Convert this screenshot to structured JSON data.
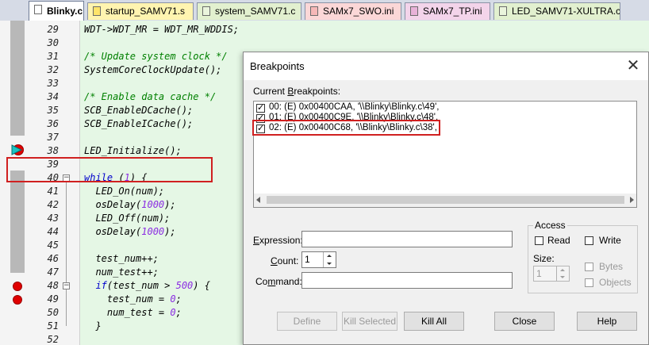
{
  "tabs": [
    {
      "label": "Blinky.c",
      "active": true,
      "color": "#ffffff",
      "icon": "c-file-icon"
    },
    {
      "label": "startup_SAMV71.s",
      "color": "#fff4b0",
      "icon": "asm-file-icon"
    },
    {
      "label": "system_SAMV71.c",
      "color": "#e2f0cf",
      "icon": "c-file-icon"
    },
    {
      "label": "SAMx7_SWO.ini",
      "color": "#fbd7d7",
      "icon": "ini-file-icon"
    },
    {
      "label": "SAMx7_TP.ini",
      "color": "#f3d4ea",
      "icon": "ini-file-icon"
    },
    {
      "label": "LED_SAMV71-XULTRA.c",
      "color": "#e2f0cf",
      "icon": "c-file-icon"
    }
  ],
  "editor": {
    "lines": [
      {
        "n": "29",
        "text": "WDT->WDT_MR = WDT_MR_WDDIS;"
      },
      {
        "n": "30",
        "text": ""
      },
      {
        "n": "31",
        "text": "/* Update system clock */"
      },
      {
        "n": "32",
        "text": "SystemCoreClockUpdate();"
      },
      {
        "n": "33",
        "text": ""
      },
      {
        "n": "34",
        "text": "/* Enable data cache */"
      },
      {
        "n": "35",
        "text": "SCB_EnableDCache();"
      },
      {
        "n": "36",
        "text": "SCB_EnableICache();"
      },
      {
        "n": "37",
        "text": ""
      },
      {
        "n": "38",
        "text": "LED_Initialize();"
      },
      {
        "n": "39",
        "text": ""
      },
      {
        "n": "40",
        "kw": "while",
        "num": "1",
        "rest": " {",
        "pre": " ("
      },
      {
        "n": "41",
        "text": "  LED_On(num);"
      },
      {
        "n": "42",
        "pre": "  osDelay(",
        "num": "1000",
        "rest": ");"
      },
      {
        "n": "43",
        "text": "  LED_Off(num);"
      },
      {
        "n": "44",
        "pre": "  osDelay(",
        "num": "1000",
        "rest": ");"
      },
      {
        "n": "45",
        "text": ""
      },
      {
        "n": "46",
        "text": "  test_num++;"
      },
      {
        "n": "47",
        "text": "  num_test++;"
      },
      {
        "n": "48",
        "kw": "  if",
        "pre": "(test_num > ",
        "num": "500",
        "rest": ") {"
      },
      {
        "n": "49",
        "pre": "    test_num = ",
        "num": "0",
        "rest": ";"
      },
      {
        "n": "50",
        "pre": "    num_test = ",
        "num": "0",
        "rest": ";"
      },
      {
        "n": "51",
        "text": "  }"
      },
      {
        "n": "52",
        "text": ""
      }
    ]
  },
  "dialog": {
    "title": "Breakpoints",
    "close_glyph": "✕",
    "current_label_pre": "Current ",
    "current_label_u": "B",
    "current_label_post": "reakpoints:",
    "breakpoints": [
      {
        "checked": true,
        "text": "00: (E) 0x00400CAA,  '\\\\Blinky\\Blinky.c\\49',"
      },
      {
        "checked": true,
        "text": "01: (E) 0x00400C9E,  '\\\\Blinky\\Blinky.c\\48',"
      },
      {
        "checked": true,
        "text": "02: (E) 0x00400C68,  '\\\\Blinky\\Blinky.c\\38',"
      }
    ],
    "expression_label": "Expression:",
    "count_label": "Count:",
    "count_value": "1",
    "command_label": "Command:",
    "access": {
      "title": "Access",
      "read": "Read",
      "write": "Write",
      "size_label": "Size:",
      "size_value": "1",
      "bytes": "Bytes",
      "objects": "Objects"
    },
    "buttons": {
      "define": "Define",
      "kill_selected": "Kill Selected",
      "kill_all": "Kill All",
      "close": "Close",
      "help": "Help"
    }
  }
}
